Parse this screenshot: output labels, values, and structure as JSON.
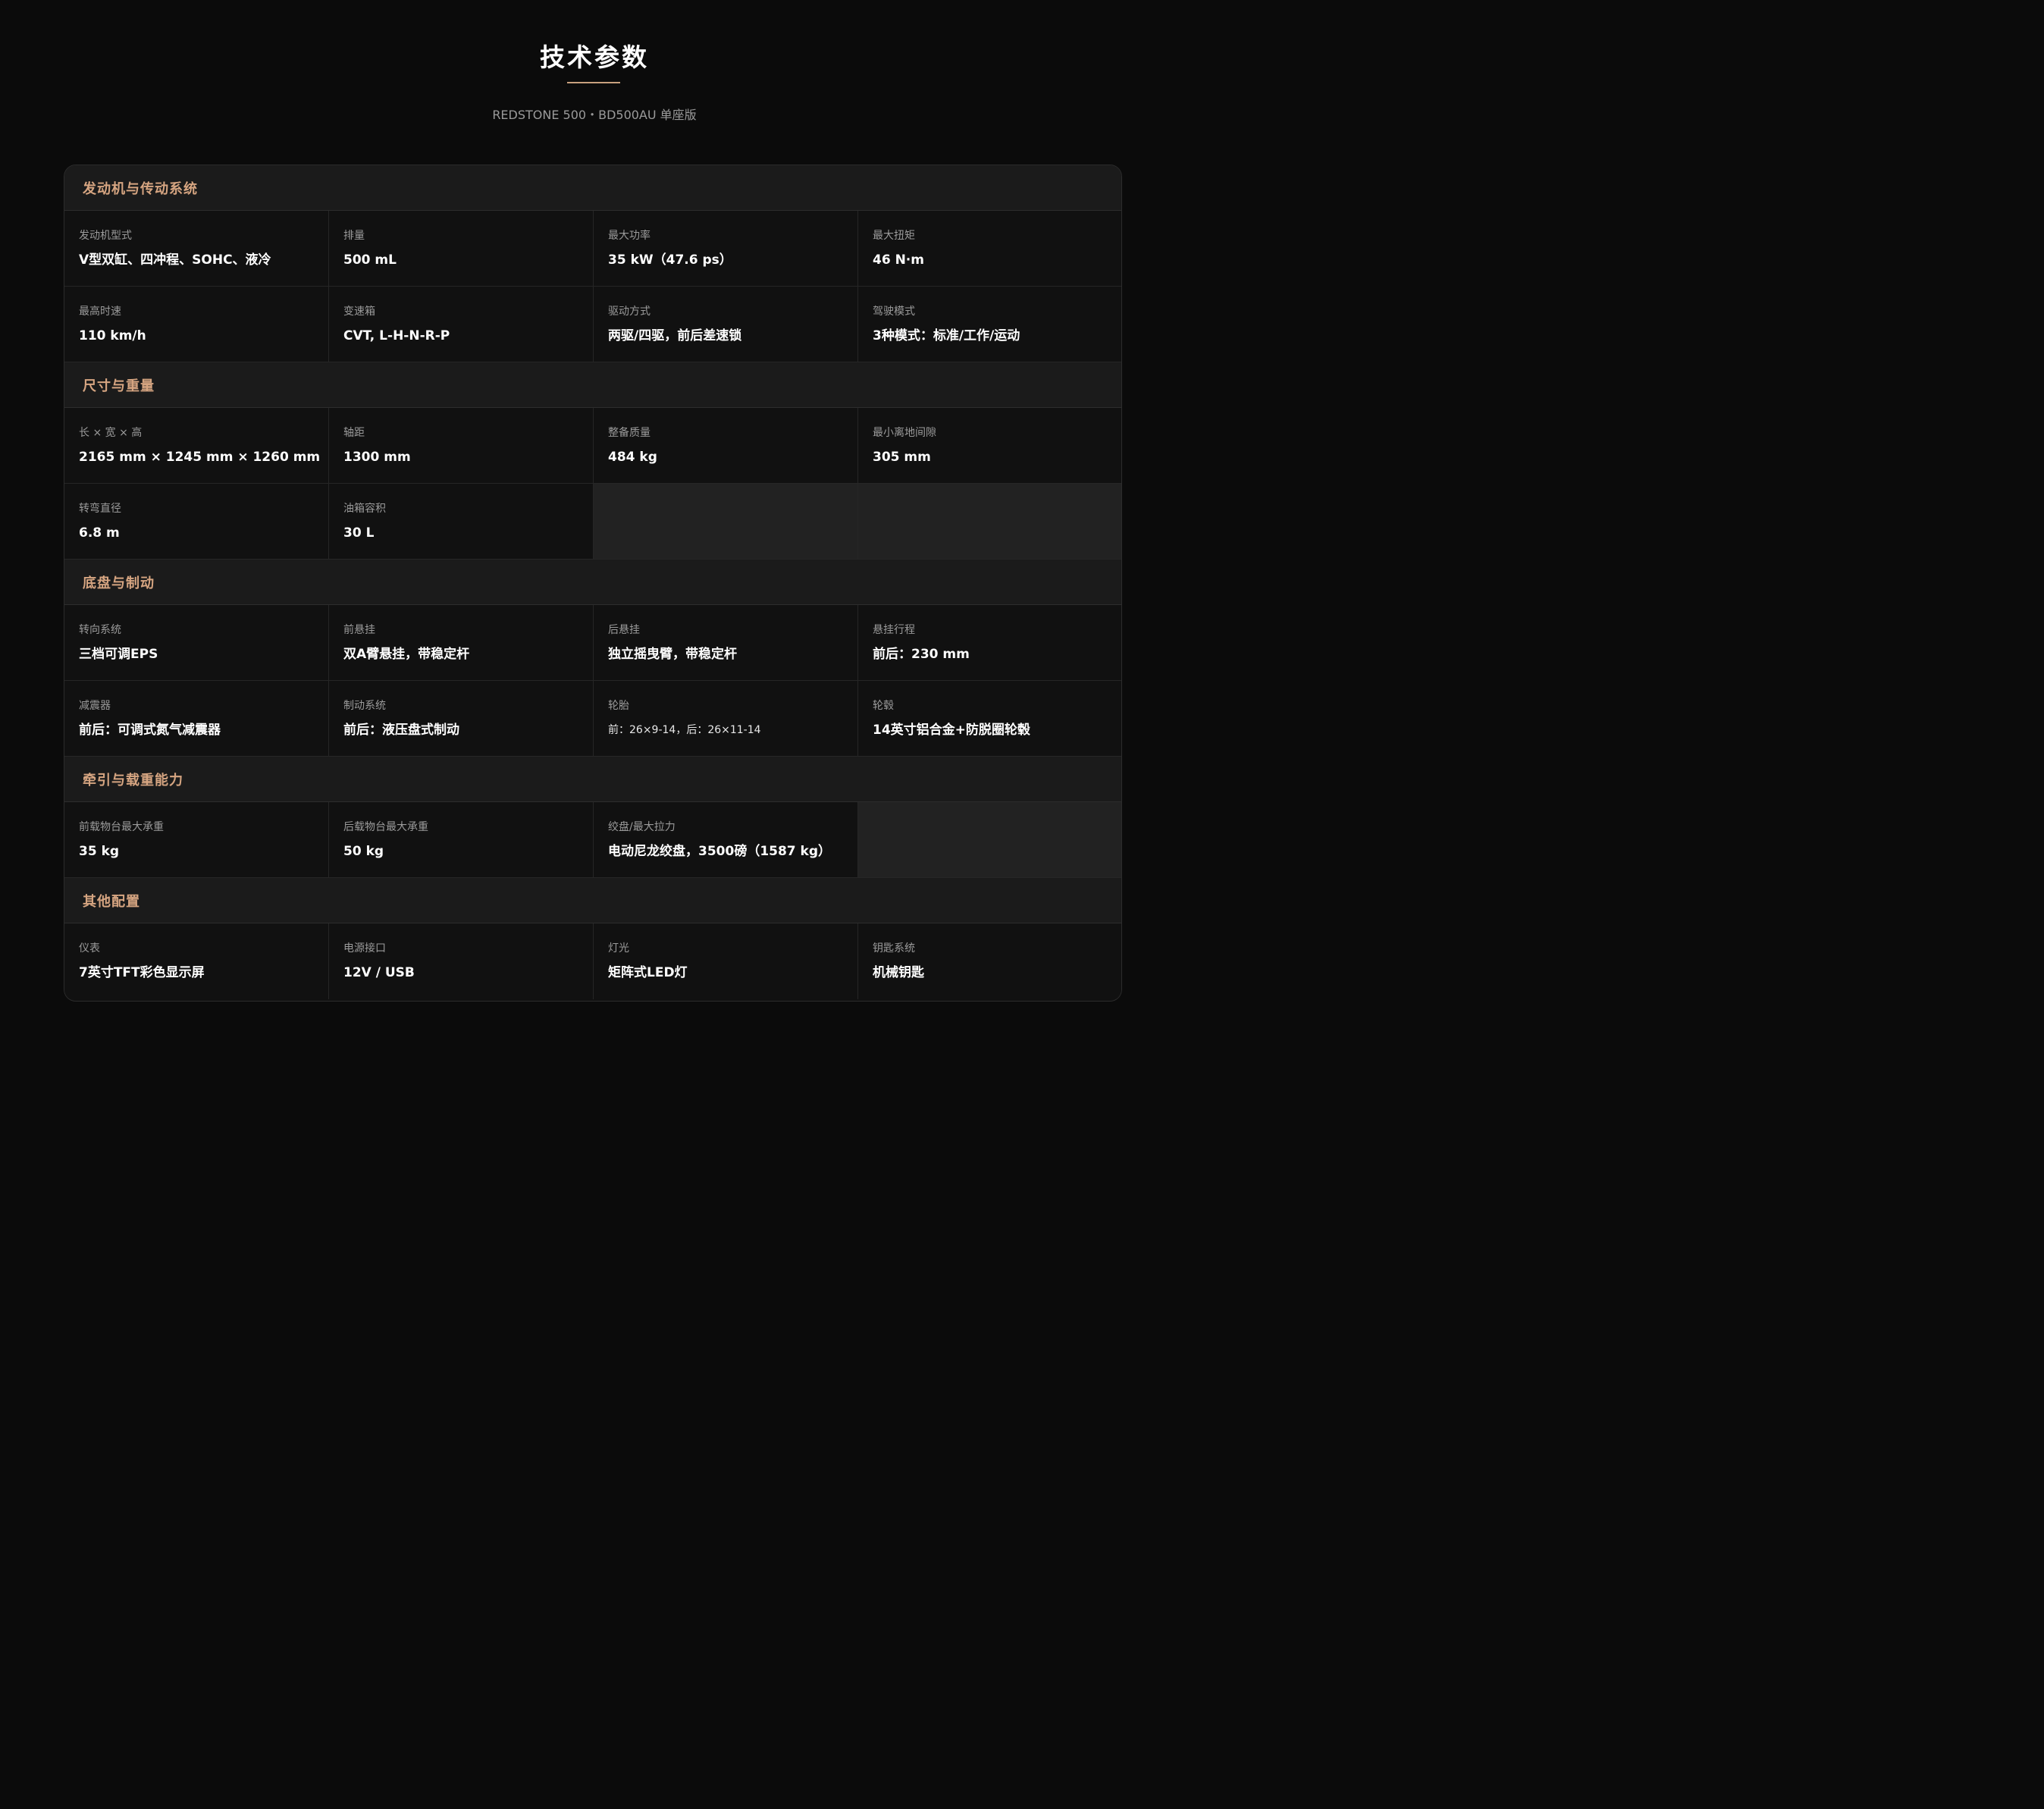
{
  "page": {
    "title": "技术参数",
    "subtitle": "REDSTONE 500・BD500AU 单座版",
    "colors": {
      "background": "#0b0b0b",
      "accent": "#c8a07e",
      "section_title": "#d6a581"
    }
  },
  "sections": [
    {
      "title": "发动机与传动系统",
      "items": [
        {
          "label": "发动机型式",
          "value": "V型双缸、四冲程、SOHC、液冷"
        },
        {
          "label": "排量",
          "value": "500 mL"
        },
        {
          "label": "最大功率",
          "value": "35 kW（47.6 ps）"
        },
        {
          "label": "最大扭矩",
          "value": "46 N·m"
        },
        {
          "label": "最高时速",
          "value": "110 km/h"
        },
        {
          "label": "变速箱",
          "value": "CVT, L-H-N-R-P"
        },
        {
          "label": "驱动方式",
          "value": "两驱/四驱，前后差速锁"
        },
        {
          "label": "驾驶模式",
          "value": "3种模式：标准/工作/运动"
        }
      ]
    },
    {
      "title": "尺寸与重量",
      "items": [
        {
          "label": "长 × 宽 × 高",
          "value": "2165 mm × 1245 mm × 1260 mm"
        },
        {
          "label": "轴距",
          "value": "1300 mm"
        },
        {
          "label": "整备质量",
          "value": "484 kg"
        },
        {
          "label": "最小离地间隙",
          "value": "305 mm"
        },
        {
          "label": "转弯直径",
          "value": "6.8 m"
        },
        {
          "label": "油箱容积",
          "value": "30 L"
        }
      ]
    },
    {
      "title": "底盘与制动",
      "items": [
        {
          "label": "转向系统",
          "value": "三档可调EPS"
        },
        {
          "label": "前悬挂",
          "value": "双A臂悬挂，带稳定杆"
        },
        {
          "label": "后悬挂",
          "value": "独立摇曳臂，带稳定杆"
        },
        {
          "label": "悬挂行程",
          "value": "前后：230 mm"
        },
        {
          "label": "减震器",
          "value": "前后：可调式氮气减震器"
        },
        {
          "label": "制动系统",
          "value": "前后：液压盘式制动"
        },
        {
          "label": "轮胎",
          "value": "前：26×9-14，后：26×11-14"
        },
        {
          "label": "轮毂",
          "value": "14英寸铝合金+防脱圈轮毂"
        }
      ]
    },
    {
      "title": "牵引与载重能力",
      "items": [
        {
          "label": "前载物台最大承重",
          "value": "35 kg"
        },
        {
          "label": "后载物台最大承重",
          "value": "50 kg"
        },
        {
          "label": "绞盘/最大拉力",
          "value": "电动尼龙绞盘，3500磅（1587 kg）"
        }
      ]
    },
    {
      "title": "其他配置",
      "items": [
        {
          "label": "仪表",
          "value": "7英寸TFT彩色显示屏"
        },
        {
          "label": "电源接口",
          "value": "12V / USB"
        },
        {
          "label": "灯光",
          "value": "矩阵式LED灯"
        },
        {
          "label": "钥匙系统",
          "value": "机械钥匙"
        }
      ]
    }
  ]
}
